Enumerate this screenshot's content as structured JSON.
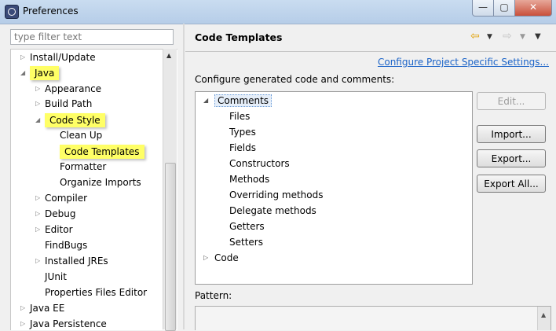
{
  "window": {
    "title": "Preferences"
  },
  "controls": {
    "minimize": "—",
    "maximize": "▢",
    "close": "✕"
  },
  "filter": {
    "placeholder": "type filter text"
  },
  "nav_tree": [
    {
      "label": "Install/Update",
      "arrow": "▷",
      "highlight": false
    },
    {
      "label": "Java",
      "arrow": "◢",
      "highlight": true
    },
    {
      "label": "Appearance",
      "arrow": "▷",
      "highlight": false
    },
    {
      "label": "Build Path",
      "arrow": "▷",
      "highlight": false
    },
    {
      "label": "Code Style",
      "arrow": "◢",
      "highlight": true
    },
    {
      "label": "Clean Up",
      "arrow": "",
      "highlight": false
    },
    {
      "label": "Code Templates",
      "arrow": "",
      "highlight": true
    },
    {
      "label": "Formatter",
      "arrow": "",
      "highlight": false
    },
    {
      "label": "Organize Imports",
      "arrow": "",
      "highlight": false
    },
    {
      "label": "Compiler",
      "arrow": "▷",
      "highlight": false
    },
    {
      "label": "Debug",
      "arrow": "▷",
      "highlight": false
    },
    {
      "label": "Editor",
      "arrow": "▷",
      "highlight": false
    },
    {
      "label": "FindBugs",
      "arrow": "",
      "highlight": false
    },
    {
      "label": "Installed JREs",
      "arrow": "▷",
      "highlight": false
    },
    {
      "label": "JUnit",
      "arrow": "",
      "highlight": false
    },
    {
      "label": "Properties Files Editor",
      "arrow": "",
      "highlight": false
    },
    {
      "label": "Java EE",
      "arrow": "▷",
      "highlight": false
    },
    {
      "label": "Java Persistence",
      "arrow": "▷",
      "highlight": false
    }
  ],
  "page": {
    "title": "Code Templates",
    "configure_link": "Configure Project Specific Settings...",
    "description": "Configure generated code and comments:",
    "pattern_label": "Pattern:"
  },
  "templates": [
    {
      "label": "Comments",
      "arrow": "◢",
      "selected": true
    },
    {
      "label": "Files",
      "arrow": "",
      "selected": false
    },
    {
      "label": "Types",
      "arrow": "",
      "selected": false
    },
    {
      "label": "Fields",
      "arrow": "",
      "selected": false
    },
    {
      "label": "Constructors",
      "arrow": "",
      "selected": false
    },
    {
      "label": "Methods",
      "arrow": "",
      "selected": false
    },
    {
      "label": "Overriding methods",
      "arrow": "",
      "selected": false
    },
    {
      "label": "Delegate methods",
      "arrow": "",
      "selected": false
    },
    {
      "label": "Getters",
      "arrow": "",
      "selected": false
    },
    {
      "label": "Setters",
      "arrow": "",
      "selected": false
    },
    {
      "label": "Code",
      "arrow": "▷",
      "selected": false
    }
  ],
  "buttons": {
    "edit": "Edit...",
    "import": "Import...",
    "export": "Export...",
    "export_all": "Export All..."
  },
  "colors": {
    "highlight": "#ffff66",
    "link": "#1c64c8"
  }
}
